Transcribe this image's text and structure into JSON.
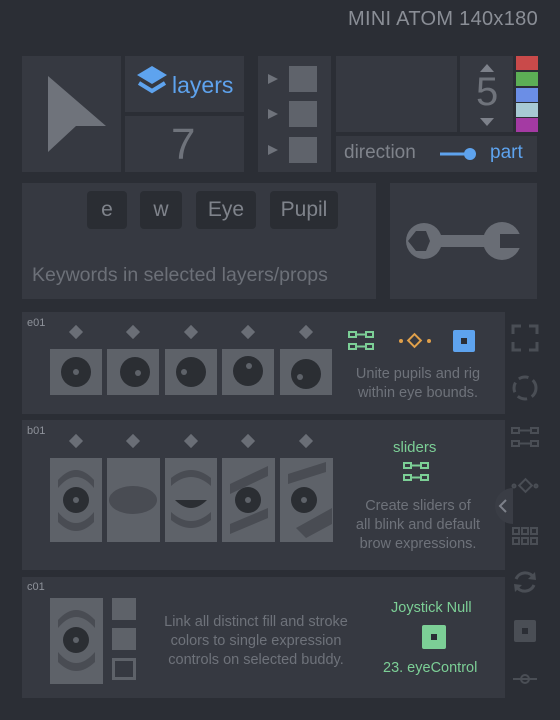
{
  "app_title": "MINI ATOM 140x180",
  "layers": {
    "label": "layers",
    "count": "7"
  },
  "stepper": {
    "value": "5"
  },
  "direction": {
    "label": "direction",
    "value_label": "part"
  },
  "swatch_colors": [
    "#c94a4a",
    "#5cae55",
    "#6b8ee6",
    "#a7c9d4",
    "#a43aa3"
  ],
  "keywords": {
    "items": [
      "e",
      "w",
      "Eye",
      "Pupil"
    ],
    "hint": "Keywords in selected layers/props"
  },
  "rows": {
    "e01": {
      "id": "e01",
      "desc_line1": "Unite pupils and rig",
      "desc_line2": "within eye bounds."
    },
    "b01": {
      "id": "b01",
      "action": "sliders",
      "desc_line1": "Create sliders of",
      "desc_line2": "all blink and default",
      "desc_line3": "brow expressions."
    },
    "c01": {
      "id": "c01",
      "desc_line1": "Link all distinct fill and stroke",
      "desc_line2": "colors to single expression",
      "desc_line3": "controls on selected buddy.",
      "null_label": "Joystick Null",
      "control_label": "23. eyeControl"
    }
  },
  "colors": {
    "accent_blue": "#5ea3ee",
    "accent_green": "#7ccf96",
    "panel": "#363941",
    "background": "#2b2e35"
  }
}
